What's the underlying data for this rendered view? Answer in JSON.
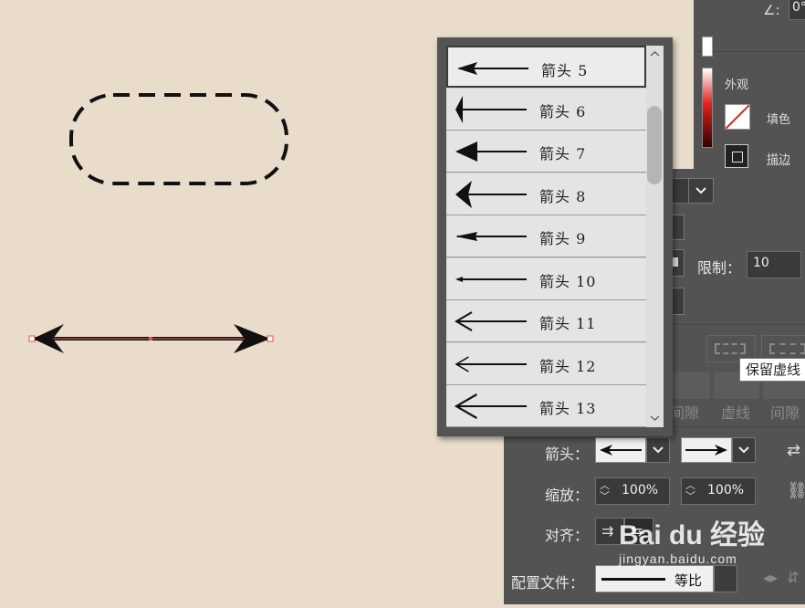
{
  "appearance": {
    "angle_value": "0°",
    "section_title": "外观",
    "fill_label": "填色",
    "stroke_label": "描边"
  },
  "stroke_panel": {
    "limit_label": "限制：",
    "limit_value": "10",
    "dash_headers": [
      "间隙",
      "虚线",
      "间隙"
    ],
    "arrowheads_label": "箭头：",
    "scale_label": "缩放：",
    "scale_start": "100%",
    "scale_end": "100%",
    "align_label": "对齐：",
    "profile_label": "配置文件：",
    "profile_value": "等比"
  },
  "arrow_list": {
    "items": [
      {
        "label": "箭头  5",
        "style": "solid-open"
      },
      {
        "label": "箭头  6",
        "style": "solid-tall"
      },
      {
        "label": "箭头  7",
        "style": "solid-wide"
      },
      {
        "label": "箭头  8",
        "style": "solid-concave"
      },
      {
        "label": "箭头  9",
        "style": "solid-narrow"
      },
      {
        "label": "箭头  10",
        "style": "small"
      },
      {
        "label": "箭头  11",
        "style": "open"
      },
      {
        "label": "箭头  12",
        "style": "open-thin"
      },
      {
        "label": "箭头  13",
        "style": "open-large"
      }
    ],
    "selected_index": 0
  },
  "tooltip": "保留虚线",
  "watermark": {
    "brand": "Bai du 经验",
    "url": "jingyan.baidu.com"
  },
  "colors": {
    "canvas": "#e9dccb",
    "panel": "#535353",
    "list_item": "#e4e4e4"
  }
}
